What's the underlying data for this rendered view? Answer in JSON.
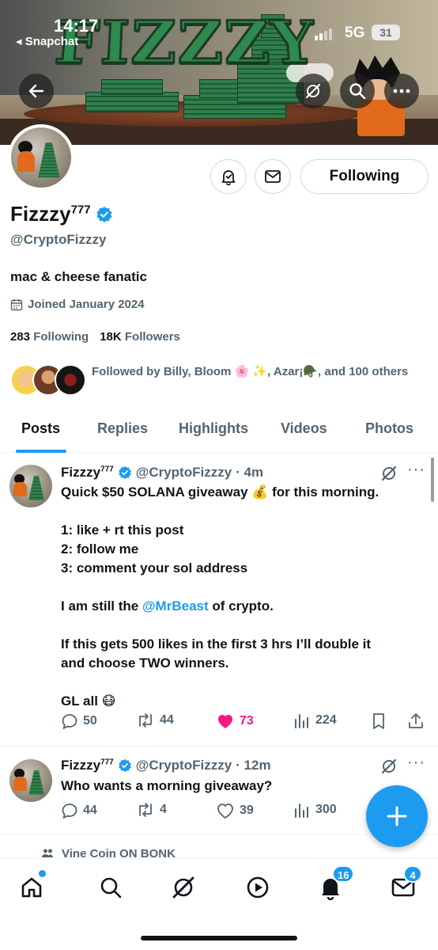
{
  "status_bar": {
    "time": "14:17",
    "back_app": "◂ Snapchat",
    "network": "5G",
    "battery": "31"
  },
  "banner": {
    "title": "FIZZZY"
  },
  "profile": {
    "display_name": "Fizzzy",
    "name_sup": "777",
    "handle": "@CryptoFizzzy",
    "bio": "mac & cheese fanatic",
    "joined": "Joined January 2024",
    "following_count": "283",
    "following_label": "Following",
    "followers_count": "18K",
    "followers_label": "Followers",
    "followed_by": "Followed by Billy, Bloom 🌸 ✨, Azar¡🪖, and 100 others",
    "follow_button": "Following"
  },
  "tabs": [
    "Posts",
    "Replies",
    "Highlights",
    "Videos",
    "Photos"
  ],
  "posts": [
    {
      "name": "Fizzzy",
      "name_sup": "777",
      "handle": "@CryptoFizzzy",
      "time": "· 4m",
      "lines": [
        "Quick $50 SOLANA giveaway 💰 for this morning.",
        "",
        "1: like + rt this post",
        "2: follow me",
        "3: comment your sol address",
        "",
        "",
        "",
        "If this gets 500 likes in the first 3 hrs I’ll double it",
        "and choose TWO winners.",
        "",
        "GL all 😷"
      ],
      "mention_line": {
        "before": "I am still the ",
        "mention": "@MrBeast",
        "after": " of crypto."
      },
      "replies": "50",
      "reposts": "44",
      "likes": "73",
      "views": "224"
    },
    {
      "name": "Fizzzy",
      "name_sup": "777",
      "handle": "@CryptoFizzzy",
      "time": "· 12m",
      "text": "Who wants a morning giveaway?",
      "replies": "44",
      "reposts": "4",
      "likes": "39",
      "views": "300"
    }
  ],
  "peek_text": "Vine Coin ON BONK",
  "bottom_nav": {
    "notifications_badge": "16",
    "messages_badge": "4"
  },
  "colors": {
    "accent": "#1d9bf0",
    "like": "#f91880",
    "secondary_text": "#536471"
  }
}
